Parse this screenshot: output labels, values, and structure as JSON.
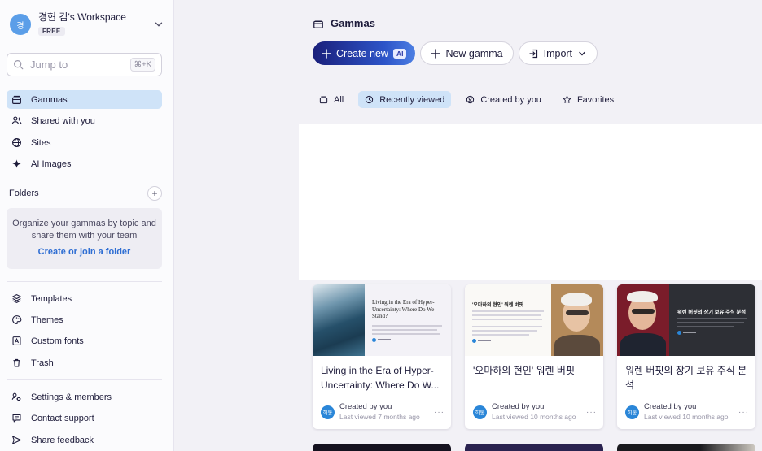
{
  "workspace": {
    "avatar": "경",
    "name": "경현 김's Workspace",
    "plan": "FREE"
  },
  "search": {
    "placeholder": "Jump to",
    "shortcut": "⌘+K"
  },
  "nav": {
    "gammas": "Gammas",
    "shared": "Shared with you",
    "sites": "Sites",
    "ai_images": "AI Images"
  },
  "folders": {
    "header": "Folders",
    "hint": "Organize your gammas by topic and share them with your team",
    "link": "Create or join a folder"
  },
  "bottom_nav": {
    "templates": "Templates",
    "themes": "Themes",
    "custom_fonts": "Custom fonts",
    "trash": "Trash",
    "settings": "Settings & members",
    "support": "Contact support",
    "feedback": "Share feedback"
  },
  "main": {
    "title": "Gammas",
    "create_new": "Create new",
    "ai_badge": "AI",
    "new_gamma": "New gamma",
    "import": "Import"
  },
  "tabs": {
    "all": "All",
    "recent": "Recently viewed",
    "created": "Created by you",
    "favorites": "Favorites"
  },
  "cards": [
    {
      "title": "Living in the Era of Hyper-Uncertainty: Where Do W...",
      "thumb_title": "Living in the Era of Hyper-Uncertainty: Where Do We Stand?",
      "author_initials": "희동",
      "created": "Created by you",
      "viewed": "Last viewed 7 months ago"
    },
    {
      "title": "'오마하의 현인' 워렌 버핏",
      "thumb_title": "'오마하의 현인' 워렌 버핏",
      "author_initials": "희동",
      "created": "Created by you",
      "viewed": "Last viewed 10 months ago"
    },
    {
      "title": "워렌 버핏의 장기 보유 주식 분석",
      "thumb_title": "워렌 버핏의 장기 보유 주식 분석",
      "author_initials": "희동",
      "created": "Created by you",
      "viewed": "Last viewed 10 months ago"
    }
  ],
  "colors": {
    "accent": "#2f6ed3",
    "active_bg": "#cfe3f8",
    "primary_btn": "#1a1f7a"
  }
}
